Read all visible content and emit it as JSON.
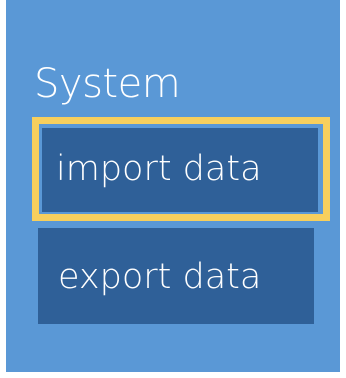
{
  "system_section": {
    "title": "System",
    "import_button_label": "import data",
    "export_button_label": "export data"
  },
  "colors": {
    "panel_background": "#5a98d6",
    "button_background": "#2f6098",
    "focus_highlight": "#f7cf5d",
    "text": "#ffffff"
  }
}
